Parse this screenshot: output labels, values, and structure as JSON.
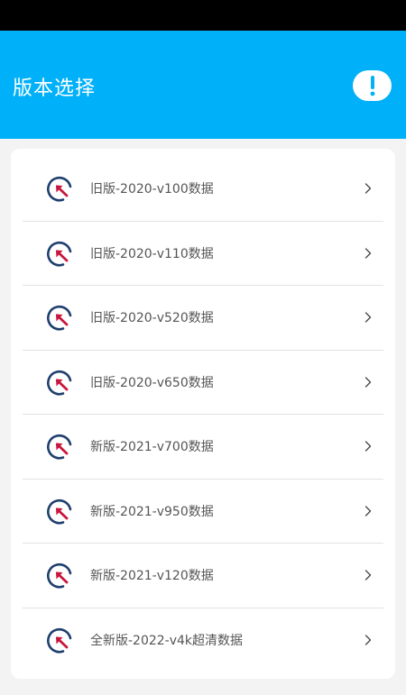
{
  "header": {
    "title": "版本选择",
    "info_icon": "exclamation-icon"
  },
  "colors": {
    "header_bg": "#00b0f8",
    "status_bar": "#000000",
    "icon_ring": "#1f3f6e",
    "icon_arrow": "#c8173c"
  },
  "list": {
    "items": [
      {
        "label": "旧版-2020-v100数据",
        "icon": "version-icon"
      },
      {
        "label": "旧版-2020-v110数据",
        "icon": "version-icon"
      },
      {
        "label": "旧版-2020-v520数据",
        "icon": "version-icon"
      },
      {
        "label": "旧版-2020-v650数据",
        "icon": "version-icon"
      },
      {
        "label": "新版-2021-v700数据",
        "icon": "version-icon"
      },
      {
        "label": "新版-2021-v950数据",
        "icon": "version-icon"
      },
      {
        "label": "新版-2021-v120数据",
        "icon": "version-icon"
      },
      {
        "label": "全新版-2022-v4k超清数据",
        "icon": "version-icon"
      }
    ]
  }
}
